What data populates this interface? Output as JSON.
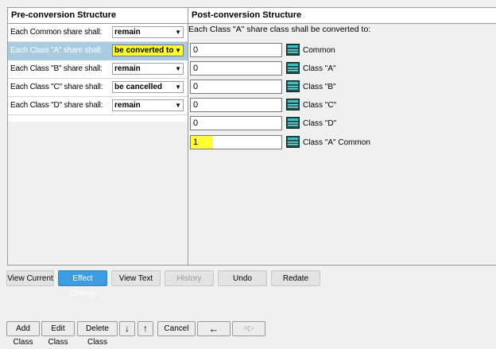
{
  "pre": {
    "header": "Pre-conversion Structure",
    "rows": [
      {
        "label": "Each Common share shall:",
        "value": "remain"
      },
      {
        "label": "Each Class \"A\" share shall:",
        "value": "be converted to"
      },
      {
        "label": "Each Class \"B\" share shall:",
        "value": "remain"
      },
      {
        "label": "Each Class \"C\" share shall:",
        "value": "be cancelled"
      },
      {
        "label": "Each Class \"D\" share shall:",
        "value": "remain"
      }
    ],
    "selected_row": 1
  },
  "post": {
    "header": "Post-conversion Structure",
    "description": "Each Class \"A\" share class shall be converted to:",
    "rows": [
      {
        "value": "0",
        "label": "Common"
      },
      {
        "value": "0",
        "label": "Class \"A\""
      },
      {
        "value": "0",
        "label": "Class \"B\""
      },
      {
        "value": "0",
        "label": "Class \"C\""
      },
      {
        "value": "0",
        "label": "Class \"D\""
      },
      {
        "value": "1",
        "label": "Class \"A\" Common"
      }
    ]
  },
  "buttons": {
    "view_current": "View Current",
    "effect_change": "Effect Change",
    "view_text": "View Text",
    "history": "History",
    "undo": "Undo",
    "redate": "Redate"
  },
  "bottom_buttons": {
    "add_class": "Add Class",
    "edit_class": "Edit Class",
    "delete_class": "Delete Class",
    "move_down": "↓",
    "move_up": "↑",
    "cancel": "Cancel",
    "back": "←",
    "next": "=▷"
  },
  "colors": {
    "highlight": "#ffff33",
    "primary_button": "#3d9de0",
    "selected_row": "#a9cbe0"
  }
}
